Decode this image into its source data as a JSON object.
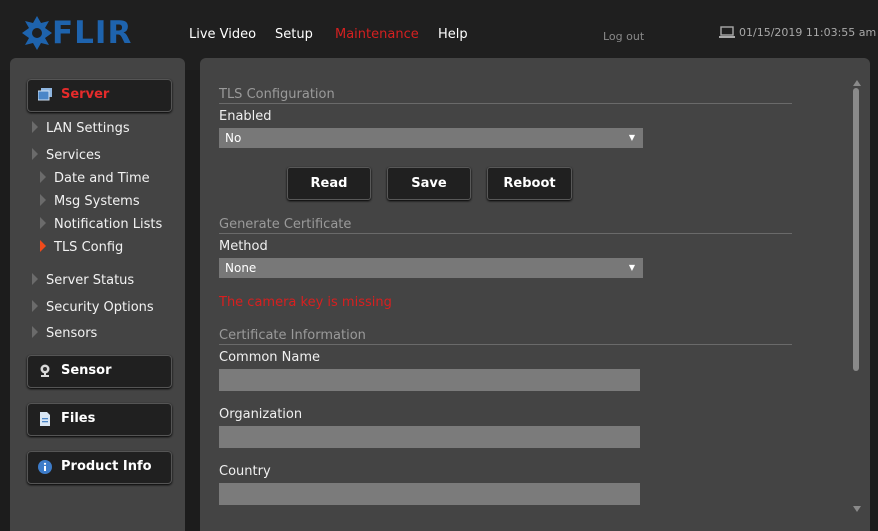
{
  "brand": {
    "logo_text": "FLIR",
    "color": "#1e63ad"
  },
  "nav": {
    "items": [
      {
        "label": "Live Video"
      },
      {
        "label": "Setup"
      },
      {
        "label": "Maintenance",
        "active": true
      },
      {
        "label": "Help"
      }
    ],
    "logout": "Log out",
    "datetime": "01/15/2019 11:03:55 am",
    "active_color": "#d42020"
  },
  "sidebar": {
    "server_label": "Server",
    "server_items": {
      "lan": "LAN Settings",
      "services": "Services",
      "date_time": "Date and Time",
      "msg_systems": "Msg Systems",
      "notification_lists": "Notification Lists",
      "tls_config": "TLS Config",
      "server_status": "Server Status",
      "security_options": "Security Options",
      "sensors": "Sensors"
    },
    "sensor_label": "Sensor",
    "files_label": "Files",
    "product_info_label": "Product Info"
  },
  "tls": {
    "section_title": "TLS Configuration",
    "enabled_label": "Enabled",
    "enabled_value": "No",
    "buttons": {
      "read": "Read",
      "save": "Save",
      "reboot": "Reboot"
    }
  },
  "generate": {
    "section_title": "Generate Certificate",
    "method_label": "Method",
    "method_value": "None",
    "error_message": "The camera key is missing",
    "error_color": "#d81f1f"
  },
  "certificate": {
    "section_title": "Certificate Information",
    "common_name_label": "Common Name",
    "common_name_value": "",
    "organization_label": "Organization",
    "organization_value": "",
    "country_label": "Country",
    "country_value": ""
  }
}
